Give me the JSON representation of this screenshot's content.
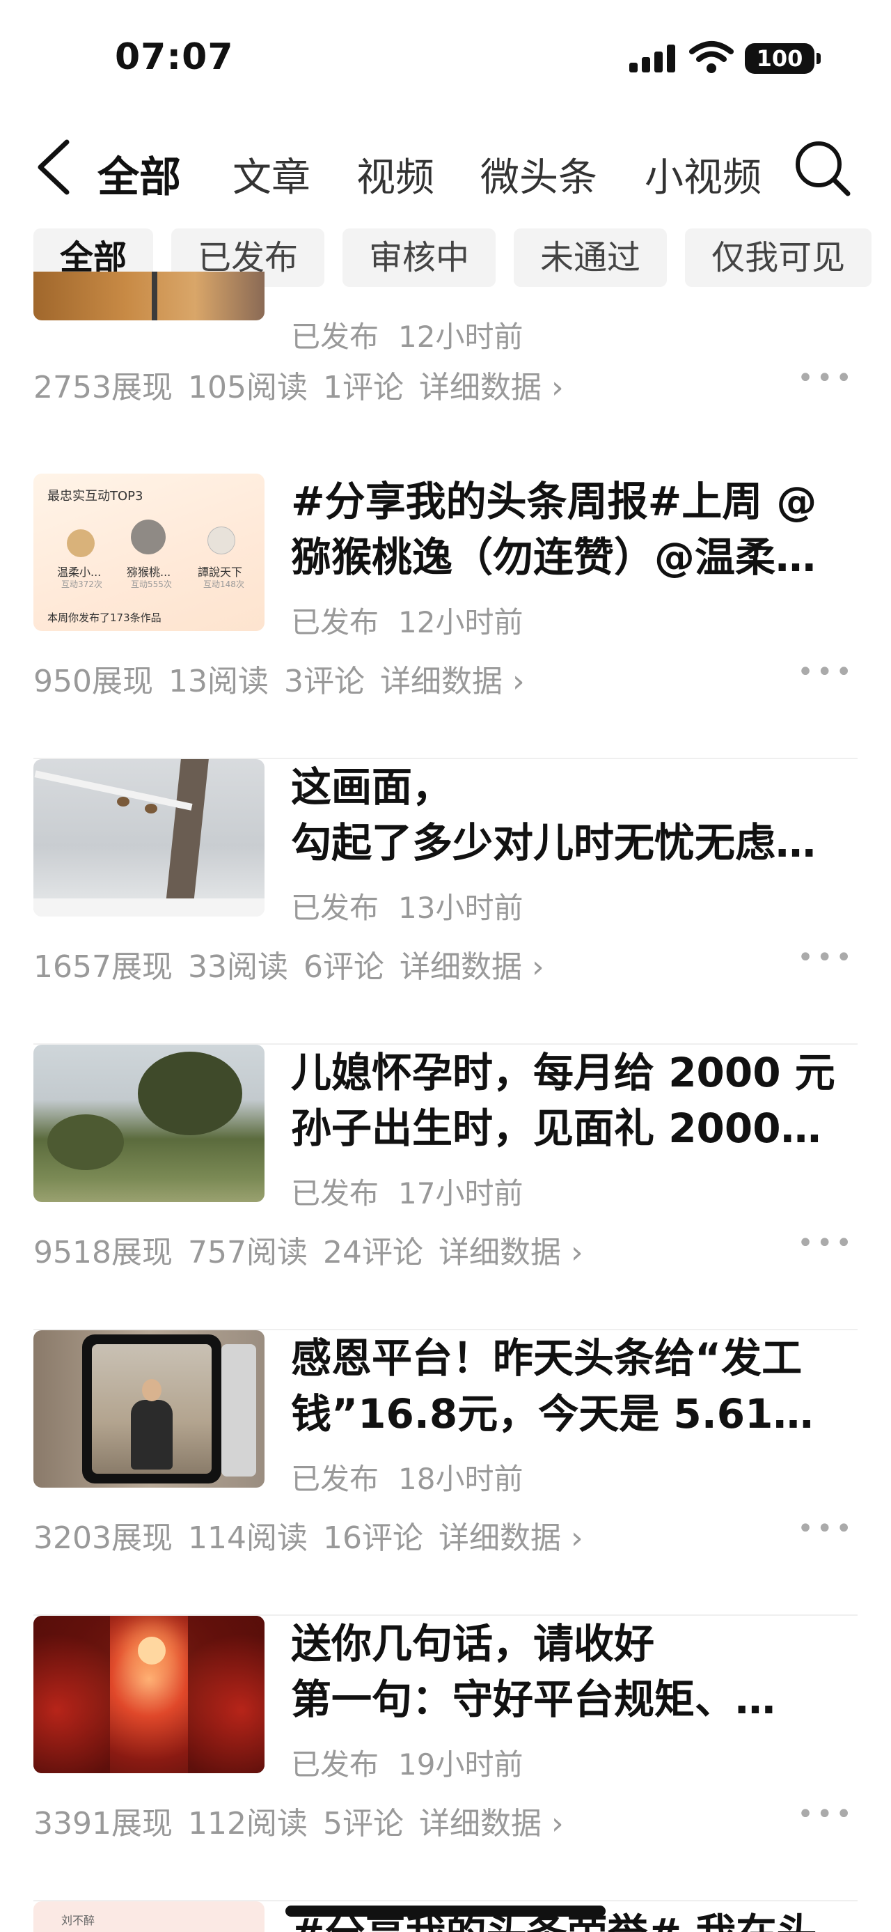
{
  "status_bar": {
    "time": "07:07",
    "battery": "100"
  },
  "nav": {
    "tabs": [
      {
        "label": "全部",
        "active": true
      },
      {
        "label": "文章",
        "active": false
      },
      {
        "label": "视频",
        "active": false
      },
      {
        "label": "微头条",
        "active": false
      },
      {
        "label": "小视频",
        "active": false
      }
    ]
  },
  "filters": [
    {
      "label": "全部",
      "active": true
    },
    {
      "label": "已发布",
      "active": false
    },
    {
      "label": "审核中",
      "active": false
    },
    {
      "label": "未通过",
      "active": false
    },
    {
      "label": "仅我可见",
      "active": false
    }
  ],
  "items": [
    {
      "title_lines": [],
      "status": "已发布",
      "time": "12小时前",
      "views": "2753展现",
      "reads": "105阅读",
      "comments": "1评论",
      "detail": "详细数据 ›",
      "thumb": "wood"
    },
    {
      "title_lines": [
        "#分享我的头条周报#上周 @",
        "猕猴桃逸（勿连赞）@温柔…"
      ],
      "status": "已发布",
      "time": "12小时前",
      "views": "950展现",
      "reads": "13阅读",
      "comments": "3评论",
      "detail": "详细数据 ›",
      "thumb": "top3",
      "thumb_text": {
        "heading": "最忠实互动TOP3",
        "users": [
          {
            "name": "温柔小...",
            "count": "互动372次"
          },
          {
            "name": "猕猴桃...",
            "count": "互动555次"
          },
          {
            "name": "譚說天下",
            "count": "互动148次"
          }
        ],
        "footer": "本周你发布了173条作品"
      }
    },
    {
      "title_lines": [
        "这画面，",
        "勾起了多少对儿时无忧无虑…"
      ],
      "status": "已发布",
      "time": "13小时前",
      "views": "1657展现",
      "reads": "33阅读",
      "comments": "6评论",
      "detail": "详细数据 ›",
      "thumb": "snow"
    },
    {
      "title_lines": [
        "儿媳怀孕时，每月给 2000 元",
        "孙子出生时，见面礼 2000…"
      ],
      "status": "已发布",
      "time": "17小时前",
      "views": "9518展现",
      "reads": "757阅读",
      "comments": "24评论",
      "detail": "详细数据 ›",
      "thumb": "garden"
    },
    {
      "title_lines": [
        "感恩平台！昨天头条给“发工",
        "钱”16.8元，今天是 5.61…"
      ],
      "status": "已发布",
      "time": "18小时前",
      "views": "3203展现",
      "reads": "114阅读",
      "comments": "16评论",
      "detail": "详细数据 ›",
      "thumb": "camera"
    },
    {
      "title_lines": [
        "送你几句话，请收好",
        "第一句：守好平台规矩、…"
      ],
      "status": "已发布",
      "time": "19小时前",
      "views": "3391展现",
      "reads": "112阅读",
      "comments": "5评论",
      "detail": "详细数据 ›",
      "thumb": "fireworks"
    },
    {
      "title_lines": [
        "#分享我的头条荣誉# 我在头"
      ],
      "thumb": "partial",
      "thumb_text": {
        "name": "刘不醉"
      }
    }
  ]
}
